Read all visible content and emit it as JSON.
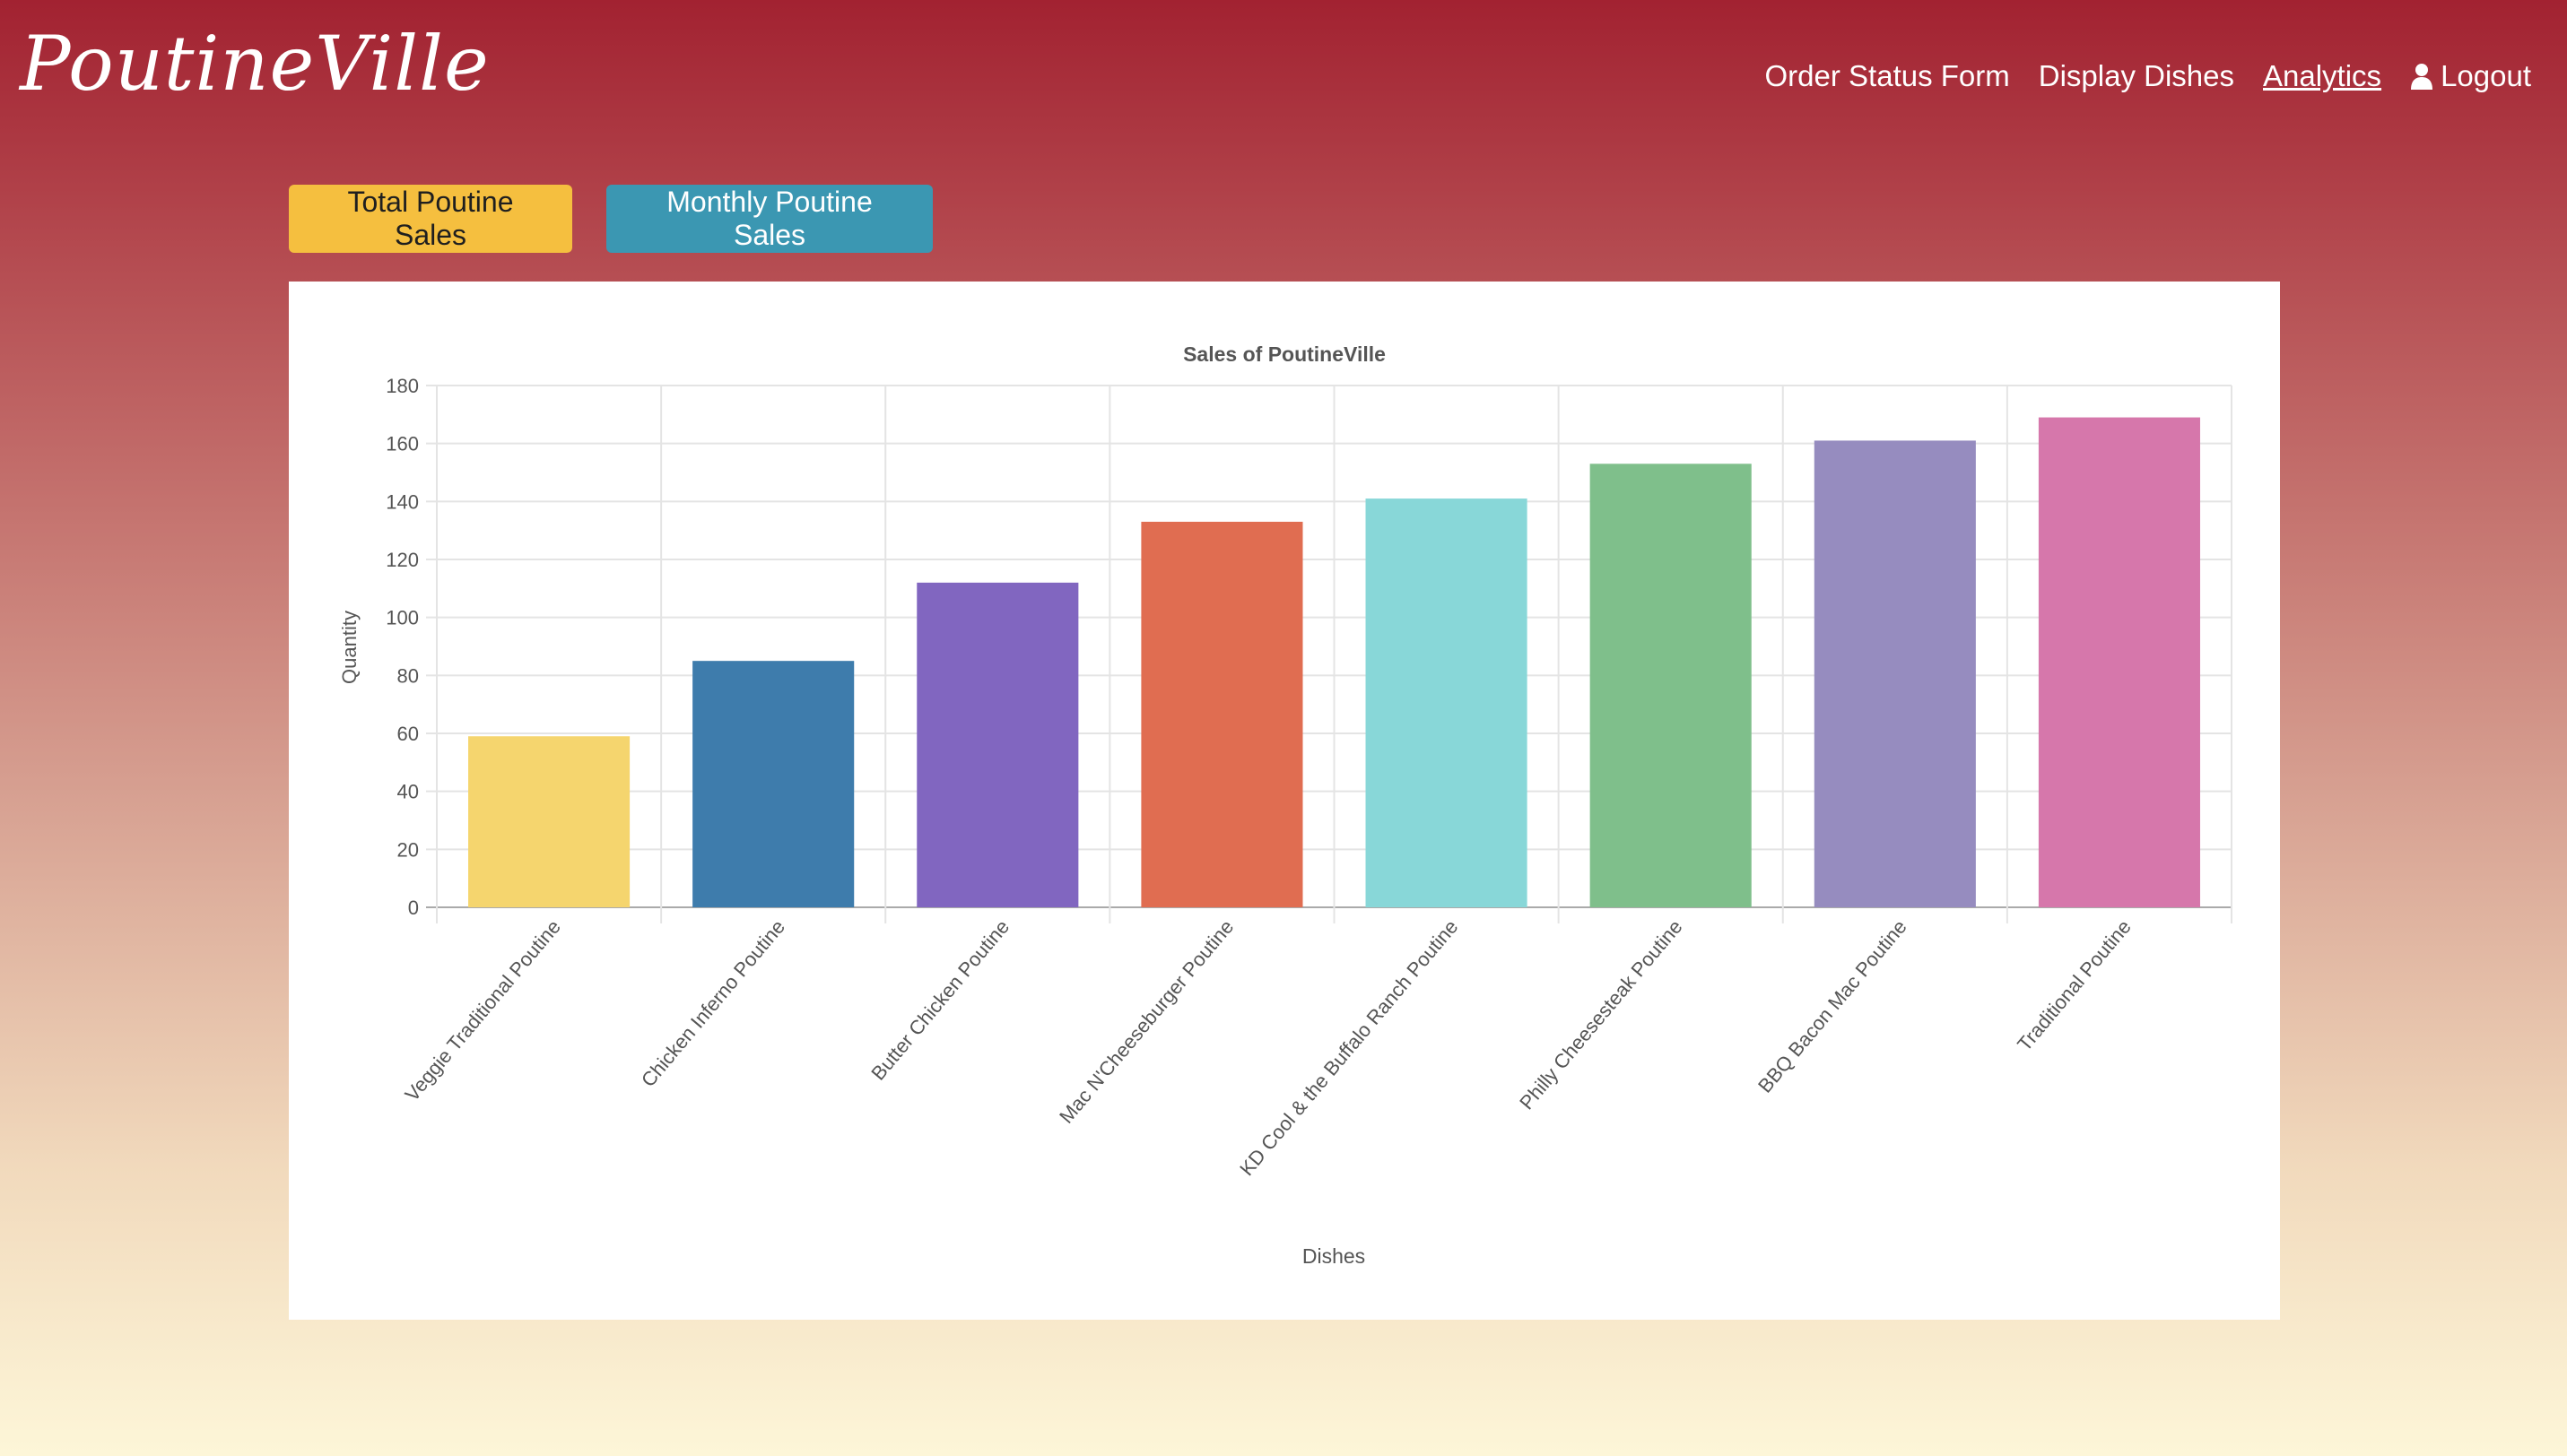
{
  "header": {
    "brand": "PoutineVille",
    "nav": {
      "order_status": "Order Status Form",
      "display_dishes": "Display Dishes",
      "analytics": "Analytics",
      "logout": "Logout"
    }
  },
  "buttons": {
    "total": "Total Poutine Sales",
    "monthly": "Monthly Poutine Sales"
  },
  "colors": {
    "total_button": "#f5bf3f",
    "monthly_button": "#3b97b2"
  },
  "chart_data": {
    "type": "bar",
    "title": "Sales of PoutineVille",
    "xlabel": "Dishes",
    "ylabel": "Quantity",
    "ylim": [
      0,
      180
    ],
    "y_ticks": [
      0,
      20,
      40,
      60,
      80,
      100,
      120,
      140,
      160,
      180
    ],
    "grid": true,
    "legend": "none",
    "categories": [
      "Veggie Traditional Poutine",
      "Chicken Inferno Poutine",
      "Butter Chicken Poutine",
      "Mac N'Cheeseburger Poutine",
      "KD Cool & the Buffalo Ranch Poutine",
      "Philly Cheesesteak Poutine",
      "BBQ Bacon Mac Poutine",
      "Traditional Poutine"
    ],
    "values": [
      59,
      85,
      112,
      133,
      141,
      153,
      161,
      169
    ],
    "colors": [
      "#f5d56e",
      "#3e7cac",
      "#8166c0",
      "#e06d51",
      "#88d7d8",
      "#7fbf8b",
      "#968cbf",
      "#d677ab"
    ]
  }
}
